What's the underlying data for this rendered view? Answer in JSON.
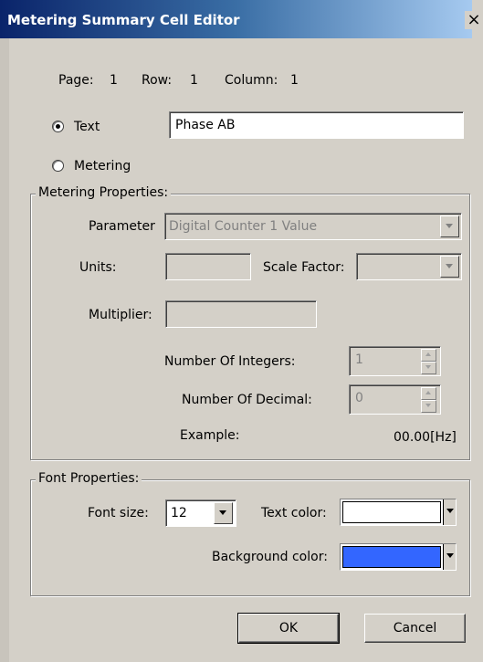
{
  "window": {
    "title": "Metering Summary Cell Editor",
    "close_glyph": "×"
  },
  "position": {
    "page_label": "Page:",
    "page_value": "1",
    "row_label": "Row:",
    "row_value": "1",
    "column_label": "Column:",
    "column_value": "1"
  },
  "mode": {
    "text_label": "Text",
    "text_selected": true,
    "text_value": "Phase AB",
    "metering_label": "Metering",
    "metering_selected": false
  },
  "metering_properties": {
    "title": "Metering Properties:",
    "parameter_label": "Parameter",
    "parameter_value": "Digital Counter 1 Value",
    "units_label": "Units:",
    "units_value": "",
    "scale_factor_label": "Scale Factor:",
    "scale_factor_value": "",
    "multiplier_label": "Multiplier:",
    "multiplier_value": "",
    "integers_label": "Number Of Integers:",
    "integers_value": "1",
    "decimals_label": "Number Of Decimal:",
    "decimals_value": "0",
    "example_label": "Example:",
    "example_value": "00.00[Hz]"
  },
  "font_properties": {
    "title": "Font Properties:",
    "font_size_label": "Font size:",
    "font_size_value": "12",
    "text_color_label": "Text color:",
    "text_color": "#ffffff",
    "background_color_label": "Background color:",
    "background_color": "#3366ff"
  },
  "buttons": {
    "ok_label": "OK",
    "cancel_label": "Cancel"
  },
  "icons": {
    "close": "close-icon",
    "dropdown": "chevron-down-icon",
    "spin_up": "spin-up-icon",
    "spin_down": "spin-down-icon"
  }
}
